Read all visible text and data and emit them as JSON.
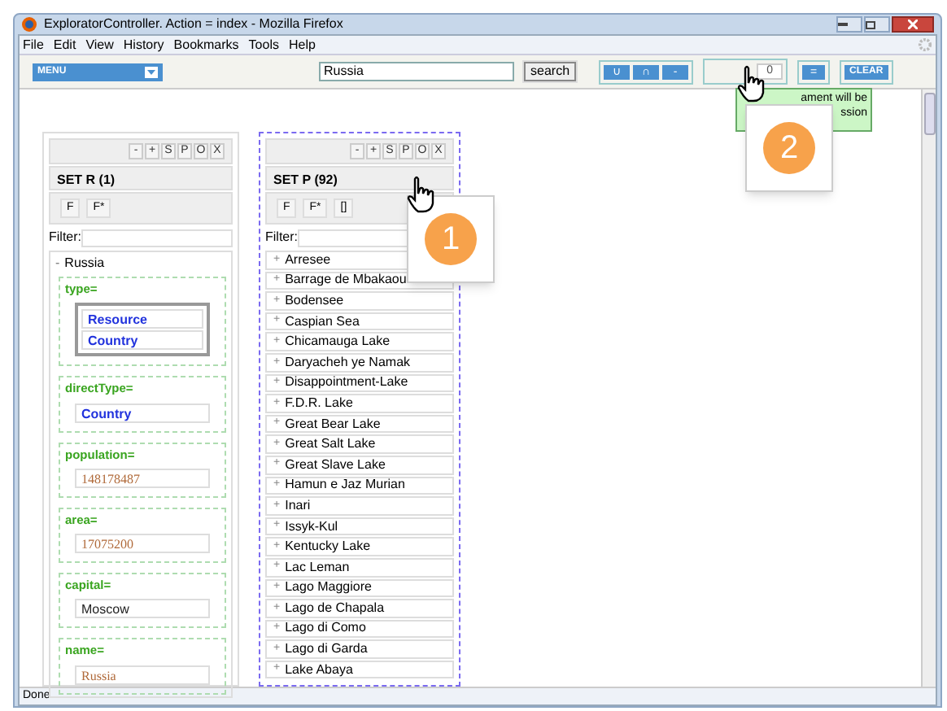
{
  "window": {
    "title": "ExploratorController. Action = index - Mozilla Firefox"
  },
  "menu_bar": [
    "File",
    "Edit",
    "View",
    "History",
    "Bookmarks",
    "Tools",
    "Help"
  ],
  "toolbar": {
    "menu_button": "MENU",
    "search": {
      "value": "Russia"
    },
    "search_button": "search",
    "set_operations": [
      "∪",
      "∩",
      "-"
    ],
    "number_field": {
      "value": "0"
    },
    "equals_button": "=",
    "clear_button": "CLEAR"
  },
  "tooltip": {
    "lines": [
      "ament will be",
      "ssion"
    ]
  },
  "callouts": [
    "1",
    "2"
  ],
  "left_panel": {
    "tools": [
      "-",
      "+",
      "S",
      "P",
      "O",
      "X"
    ],
    "title": "SET R (1)",
    "filter_buttons": [
      "F",
      "F*"
    ],
    "filter_label": "Filter:",
    "resource": {
      "toggle": "-",
      "label": "Russia",
      "properties": [
        {
          "name": "type=",
          "values": [
            {
              "text": "Resource",
              "kind": "resource"
            },
            {
              "text": "Country",
              "kind": "resource"
            }
          ]
        },
        {
          "name": "directType=",
          "values": [
            {
              "text": "Country",
              "kind": "resource"
            }
          ]
        },
        {
          "name": "population=",
          "values": [
            {
              "text": "148178487",
              "kind": "literal"
            }
          ]
        },
        {
          "name": "area=",
          "values": [
            {
              "text": "17075200",
              "kind": "literal"
            }
          ]
        },
        {
          "name": "capital=",
          "values": [
            {
              "text": "Moscow",
              "kind": "plain"
            }
          ]
        },
        {
          "name": "name=",
          "values": [
            {
              "text": "Russia",
              "kind": "literal"
            }
          ]
        }
      ]
    }
  },
  "middle_panel": {
    "tools": [
      "-",
      "+",
      "S",
      "P",
      "O",
      "X"
    ],
    "title": "SET P (92)",
    "filter_buttons": [
      "F",
      "F*",
      "[]"
    ],
    "filter_label": "Filter:",
    "items": [
      "Arresee",
      "Barrage de Mbakaou",
      "Bodensee",
      "Caspian Sea",
      "Chicamauga Lake",
      "Daryacheh ye Namak",
      "Disappointment-Lake",
      "F.D.R. Lake",
      "Great Bear Lake",
      "Great Salt Lake",
      "Great Slave Lake",
      "Hamun e Jaz Murian",
      "Inari",
      "Issyk-Kul",
      "Kentucky Lake",
      "Lac Leman",
      "Lago Maggiore",
      "Lago de Chapala",
      "Lago di Como",
      "Lago di Garda",
      "Lake Abaya"
    ],
    "item_toggle": "+"
  },
  "status_bar": "Done"
}
